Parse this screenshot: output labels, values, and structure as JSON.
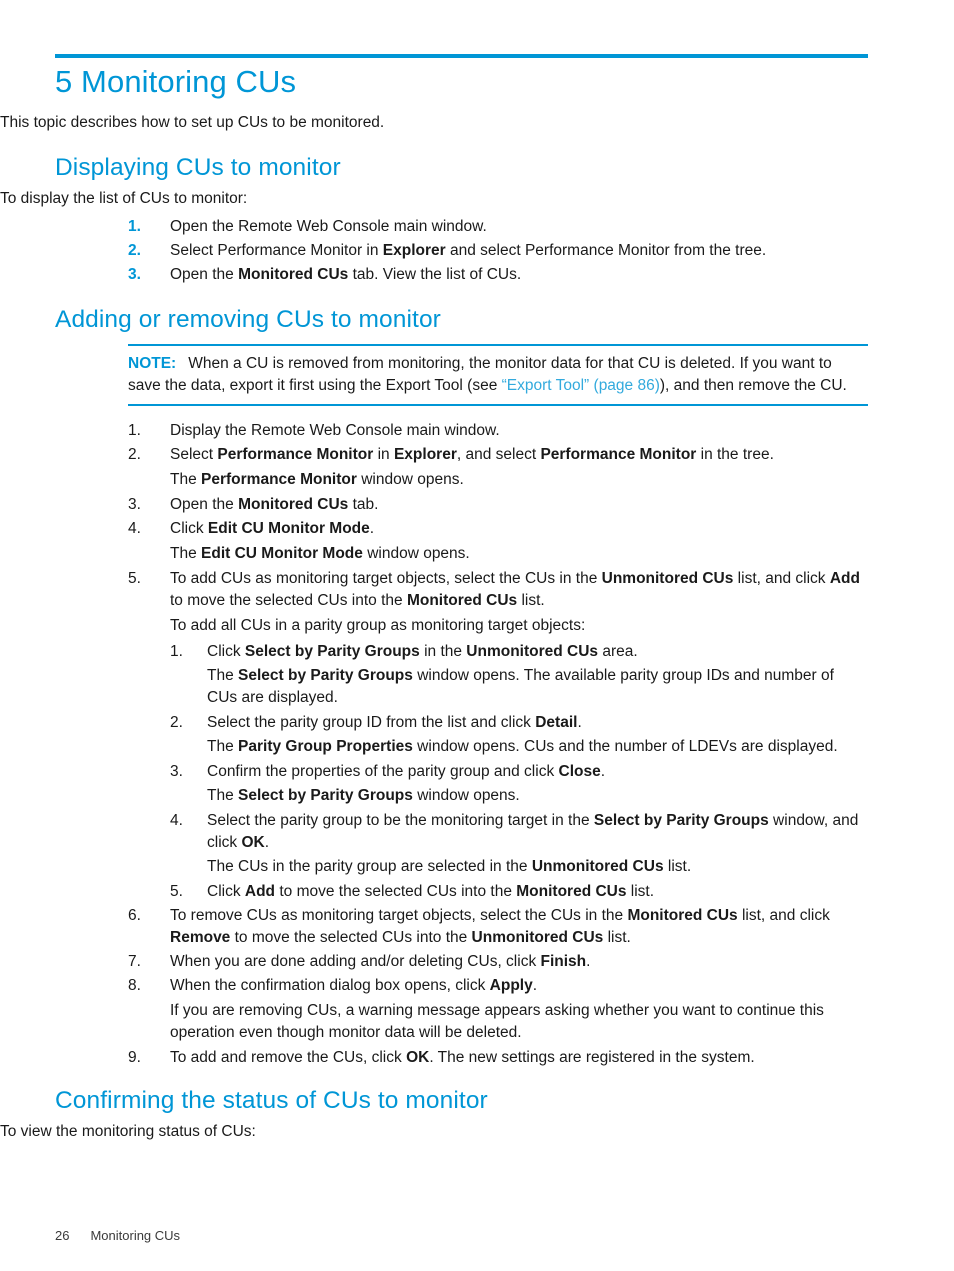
{
  "colors": {
    "accent": "#0096d6",
    "link": "#33aadd",
    "text": "#1a1a1a"
  },
  "chapter": {
    "title": "5 Monitoring CUs",
    "intro": "This topic describes how to set up CUs to be monitored."
  },
  "section1": {
    "heading": "Displaying CUs to monitor",
    "lead": "To display the list of CUs to monitor:",
    "steps": [
      {
        "num": "1.",
        "text": "Open the Remote Web Console main window."
      },
      {
        "num": "2.",
        "text": "Select Performance Monitor in Explorer and select Performance Monitor from the tree."
      },
      {
        "num": "3.",
        "text": "Open the Monitored CUs tab. View the list of CUs."
      }
    ]
  },
  "section2": {
    "heading": "Adding or removing CUs to monitor",
    "note": {
      "label": "NOTE:",
      "text_before": "When a CU is removed from monitoring, the monitor data for that CU is deleted. If you want to save the data, export it first using the Export Tool (see ",
      "link": "“Export Tool” (page 86)",
      "text_after": "), and then remove the CU."
    },
    "steps": [
      {
        "num": "1.",
        "text": "Display the Remote Web Console main window."
      },
      {
        "num": "2.",
        "text": "Select Performance Monitor in Explorer, and select Performance Monitor in the tree.",
        "result": "The Performance Monitor window opens."
      },
      {
        "num": "3.",
        "text": "Open the Monitored CUs tab."
      },
      {
        "num": "4.",
        "text": "Click Edit CU Monitor Mode.",
        "result": "The Edit CU Monitor Mode window opens."
      },
      {
        "num": "5.",
        "text": "To add CUs as monitoring target objects, select the CUs in the Unmonitored CUs list, and click Add to move the selected CUs into the Monitored CUs list.",
        "lead": "To add all CUs in a parity group as monitoring target objects:",
        "substeps": [
          {
            "num": "1.",
            "text": "Click Select by Parity Groups in the Unmonitored CUs area.",
            "result": "The Select by Parity Groups window opens. The available parity group IDs and number of CUs are displayed."
          },
          {
            "num": "2.",
            "text": "Select the parity group ID from the list and click Detail.",
            "result": "The Parity Group Properties window opens. CUs and the number of LDEVs are displayed."
          },
          {
            "num": "3.",
            "text": "Confirm the properties of the parity group and click Close.",
            "result": "The Select by Parity Groups window opens."
          },
          {
            "num": "4.",
            "text": "Select the parity group to be the monitoring target in the Select by Parity Groups window, and click OK.",
            "result": "The CUs in the parity group are selected in the Unmonitored CUs list."
          },
          {
            "num": "5.",
            "text": "Click Add to move the selected CUs into the Monitored CUs list."
          }
        ]
      },
      {
        "num": "6.",
        "text": "To remove CUs as monitoring target objects, select the CUs in the Monitored CUs list, and click Remove to move the selected CUs into the Unmonitored CUs list."
      },
      {
        "num": "7.",
        "text": "When you are done adding and/or deleting CUs, click Finish."
      },
      {
        "num": "8.",
        "text": "When the confirmation dialog box opens, click Apply.",
        "result": "If you are removing CUs, a warning message appears asking whether you want to continue this operation even though monitor data will be deleted."
      },
      {
        "num": "9.",
        "text": "To add and remove the CUs, click OK. The new settings are registered in the system."
      }
    ]
  },
  "section3": {
    "heading": "Confirming the status of CUs to monitor",
    "lead": "To view the monitoring status of CUs:"
  },
  "footer": {
    "page_number": "26",
    "chapter_name": "Monitoring CUs"
  }
}
